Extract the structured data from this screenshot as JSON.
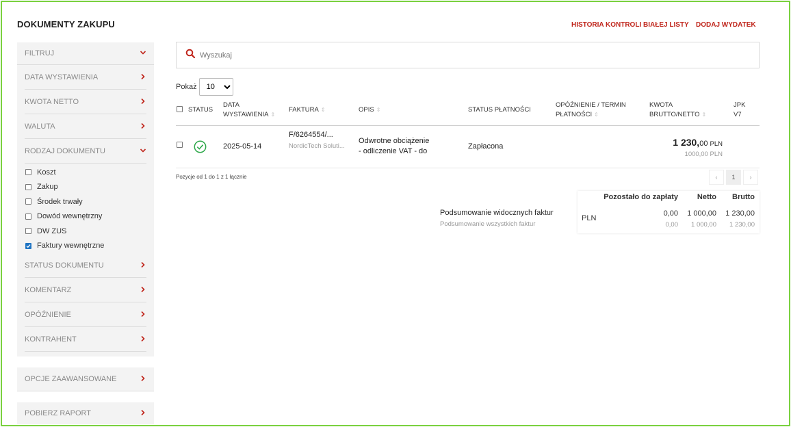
{
  "page_title": "DOKUMENTY ZAKUPU",
  "top_links": {
    "history": "HISTORIA KONTROLI BIAŁEJ LISTY",
    "add": "DODAJ WYDATEK"
  },
  "sidebar": {
    "filter": "FILTRUJ",
    "items": [
      {
        "label": "DATA WYSTAWIENIA"
      },
      {
        "label": "KWOTA NETTO"
      },
      {
        "label": "WALUTA"
      },
      {
        "label": "RODZAJ DOKUMENTU"
      }
    ],
    "doc_types": [
      {
        "label": "Koszt",
        "checked": false
      },
      {
        "label": "Zakup",
        "checked": false
      },
      {
        "label": "Środek trwały",
        "checked": false
      },
      {
        "label": "Dowód wewnętrzny",
        "checked": false
      },
      {
        "label": "DW ZUS",
        "checked": false
      },
      {
        "label": "Faktury wewnętrzne",
        "checked": true
      }
    ],
    "items2": [
      {
        "label": "STATUS DOKUMENTU"
      },
      {
        "label": "KOMENTARZ"
      },
      {
        "label": "OPÓŹNIENIE"
      },
      {
        "label": "KONTRAHENT"
      }
    ],
    "advanced": "OPCJE ZAAWANSOWANE",
    "report": "POBIERZ RAPORT"
  },
  "search": {
    "placeholder": "Wyszukaj"
  },
  "show": {
    "label": "Pokaż",
    "value": "10"
  },
  "table": {
    "headers": {
      "status": "STATUS",
      "date_1": "DATA",
      "date_2": "WYSTAWIENIA",
      "invoice": "FAKTURA",
      "desc": "OPIS",
      "payment_status": "STATUS PŁATNOŚCI",
      "delay_1": "OPÓŹNIENIE / TERMIN",
      "delay_2": "PŁATNOŚCI",
      "amount_1": "KWOTA",
      "amount_2": "BRUTTO/NETTO",
      "jpk_1": "JPK",
      "jpk_2": "V7"
    },
    "rows": [
      {
        "date": "2025-05-14",
        "invoice": "F/6264554/...",
        "vendor": "NordicTech Soluti...",
        "desc_1": "Odwrotne obciążenie",
        "desc_2": "- odliczenie VAT - do",
        "payment_status": "Zapłacona",
        "gross_main": "1 230,",
        "gross_dec": "00",
        "gross_cur": "PLN",
        "net": "1000,00 PLN",
        "status_color": "#2ea84a"
      }
    ]
  },
  "pagination": {
    "info": "Pozycje od 1 do 1 z 1 łącznie",
    "prev": "‹",
    "page": "1",
    "next": "›"
  },
  "summary": {
    "visible_label": "Podsumowanie widocznych faktur",
    "all_label": "Podsumowanie wszystkich faktur",
    "headers": {
      "remaining": "Pozostało do zapłaty",
      "net": "Netto",
      "gross": "Brutto"
    },
    "currency": "PLN",
    "visible": {
      "remaining": "0,00",
      "net": "1 000,00",
      "gross": "1 230,00"
    },
    "all": {
      "remaining": "0,00",
      "net": "1 000,00",
      "gross": "1 230,00"
    }
  },
  "colors": {
    "accent": "#c0261c",
    "checkbox": "#1f74c3",
    "frame": "#7ad13f"
  }
}
